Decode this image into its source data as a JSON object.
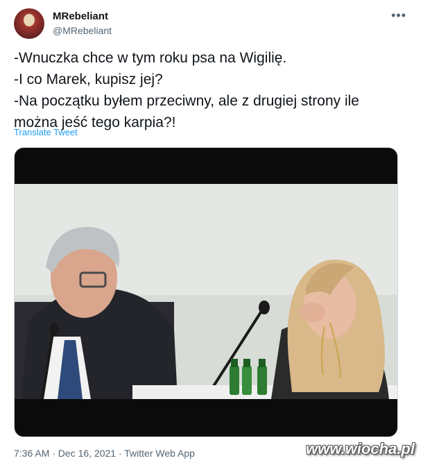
{
  "author": {
    "display_name": "MRebeliant",
    "handle": "@MRebeliant"
  },
  "tweet": {
    "lines": [
      "-Wnuczka chce w tym roku psa na Wigilię.",
      "-I co Marek, kupisz jej?",
      "-Na początku byłem przeciwny, ale z drugiej strony ile",
      "można jeść tego karpia?!"
    ],
    "translate_label": "Translate Tweet",
    "meta": "7:36 AM · Dec 16, 2021 · Twitter Web App"
  },
  "more_icon": "more-options-icon",
  "watermark": "www.wiocha.pl"
}
